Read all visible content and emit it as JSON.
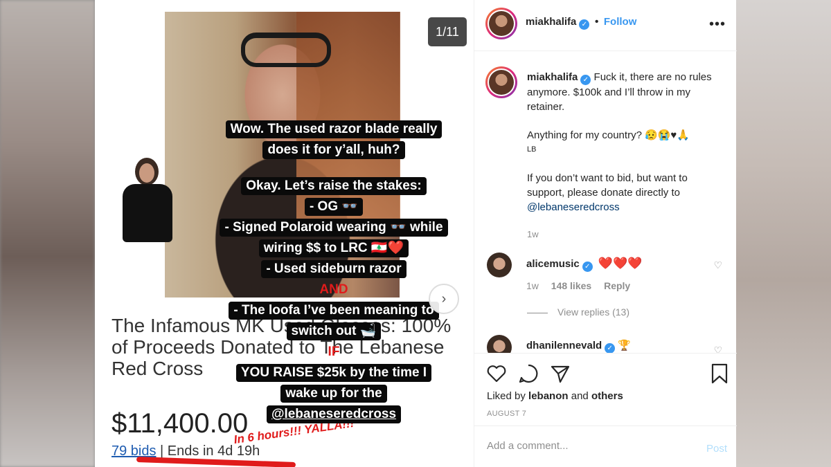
{
  "image_panel": {
    "page_counter": "1/11",
    "listing_title": "The Infamous MK Used Glasses: 100% of Proceeds Donated to The Lebanese Red Cross",
    "price": "$11,400.00",
    "bids_link": "79 bids",
    "ends_text": " | Ends in 4d 19h",
    "handwriting": "In 6 hours!!! YALLA!!!",
    "story_lines": [
      {
        "text": "Wow. The used razor blade really",
        "style": "box"
      },
      {
        "text": "does it for y’all, huh?",
        "style": "box"
      },
      {
        "text": "",
        "style": "gap"
      },
      {
        "text": "Okay. Let’s raise the stakes:",
        "style": "box"
      },
      {
        "text": "- OG 👓",
        "style": "box"
      },
      {
        "text": "- Signed Polaroid wearing 👓 while",
        "style": "box"
      },
      {
        "text": "wiring $$ to LRC 🇱🇧❤️",
        "style": "box"
      },
      {
        "text": "- Used sideburn razor",
        "style": "box"
      },
      {
        "text": "AND",
        "style": "red"
      },
      {
        "text": "- The loofa I’ve been meaning to",
        "style": "box"
      },
      {
        "text": "switch out 🛁",
        "style": "box"
      },
      {
        "text": "IF",
        "style": "red"
      },
      {
        "text": "YOU RAISE $25k by the time I",
        "style": "box"
      },
      {
        "text": "wake up for the",
        "style": "box"
      },
      {
        "text": "@lebaneseredcross",
        "style": "box-underline"
      }
    ]
  },
  "header": {
    "username": "miakhalifa",
    "follow_label": "Follow",
    "separator": "•"
  },
  "caption": {
    "username": "miakhalifa",
    "text_1": "Fuck it, there are no rules anymore. $100k and I’ll throw in my retainer.",
    "text_2": "Anything for my country? 😥😭♥🙏",
    "flag_label": "LB",
    "text_3": "If you don’t want to bid, but want to support, please donate directly to",
    "mention": "@lebaneseredcross",
    "time": "1w"
  },
  "comments": [
    {
      "username": "alicemusic",
      "text": "❤️❤️❤️",
      "time": "1w",
      "likes": "148 likes",
      "reply": "Reply",
      "view_replies": "View replies (13)"
    },
    {
      "username": "dhanilennevald",
      "text": "🏆"
    }
  ],
  "actions": {
    "liked_by_prefix": "Liked by ",
    "liked_by_user": "lebanon",
    "liked_by_and": " and ",
    "liked_by_others": "others",
    "date": "AUGUST 7"
  },
  "comment_box": {
    "placeholder": "Add a comment...",
    "post_label": "Post"
  },
  "icons": [
    "heart-icon",
    "comment-icon",
    "share-icon",
    "bookmark-icon",
    "more-icon",
    "verified-icon",
    "next-arrow-icon"
  ],
  "colors": {
    "accent": "#3897f0",
    "story_red": "#e01b1b",
    "link_blue": "#00376b"
  }
}
